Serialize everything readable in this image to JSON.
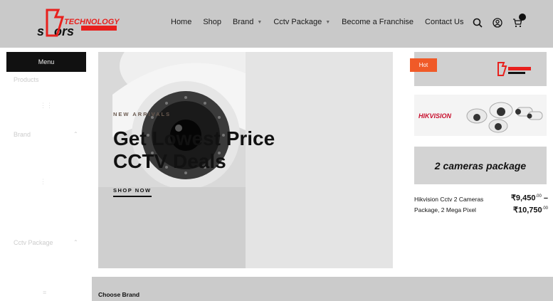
{
  "header": {
    "brand_colors": {
      "accent": "#e8201d",
      "header_bg": "#c9c9c9"
    },
    "nav": [
      {
        "label": "Home",
        "has_dropdown": false
      },
      {
        "label": "Shop",
        "has_dropdown": false
      },
      {
        "label": "Brand",
        "has_dropdown": true
      },
      {
        "label": "Cctv Package",
        "has_dropdown": true
      },
      {
        "label": "Become a Franchise",
        "has_dropdown": false
      },
      {
        "label": "Contact Us",
        "has_dropdown": false
      }
    ],
    "icons": [
      "search-icon",
      "user-icon",
      "cart-icon"
    ]
  },
  "sidebar": {
    "menu_label": "Menu",
    "categories": [
      {
        "label": "Products"
      },
      {
        "label": "Brand"
      },
      {
        "label": "Cctv Package"
      }
    ]
  },
  "hero": {
    "kicker": "NEW ARRIVALS",
    "title": "Get Lowest Price CCTV Deals",
    "cta": "SHOP NOW"
  },
  "hot": {
    "badge": "Hot",
    "banner_text": "2 cameras package",
    "product_name": "Hikvision Cctv 2 Cameras Package, 2 Mega Pixel",
    "price_low": "₹9,450",
    "price_low_dec": ".00",
    "price_sep": "–",
    "price_high": "₹10,750",
    "price_high_dec": ".00"
  },
  "brands": {
    "title": "Choose Brand"
  }
}
